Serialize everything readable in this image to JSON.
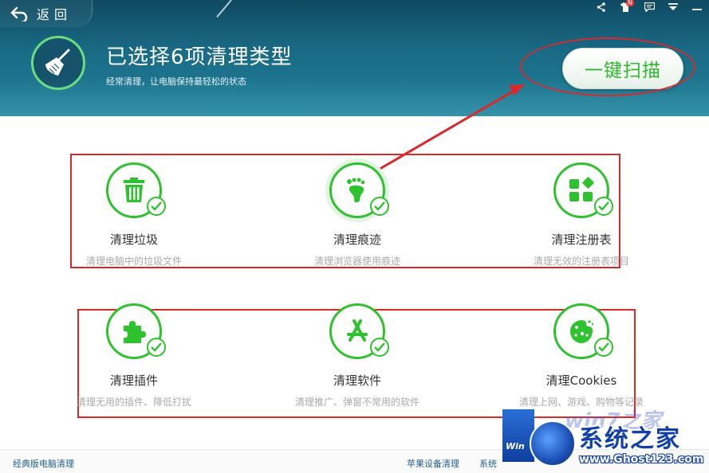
{
  "header": {
    "back_label": "返回",
    "title": "已选择6项清理类型",
    "subtitle": "经常清理，让电脑保持最轻松的状态",
    "scan_button": "一键扫描",
    "notification_badge": "N"
  },
  "items": [
    {
      "title": "清理垃圾",
      "desc": "清理电脑中的垃圾文件",
      "icon": "trash-icon"
    },
    {
      "title": "清理痕迹",
      "desc": "清理浏览器使用痕迹",
      "icon": "footprint-icon"
    },
    {
      "title": "清理注册表",
      "desc": "清理无效的注册表项目",
      "icon": "registry-icon"
    },
    {
      "title": "清理插件",
      "desc": "清理无用的插件、降低打扰",
      "icon": "puzzle-icon"
    },
    {
      "title": "清理软件",
      "desc": "清理推广、弹窗不常用的软件",
      "icon": "app-store-icon"
    },
    {
      "title": "清理Cookies",
      "desc": "清理上网、游戏、购物等记录",
      "icon": "cookie-icon"
    }
  ],
  "footer": {
    "classic_link": "经典版电脑清理",
    "apple_link": "苹果设备清理",
    "system_link": "系统"
  },
  "watermark": {
    "brand": "系统之家",
    "url": "www.Ghost123.com",
    "faded": "win7之家",
    "bar_text": "Win"
  },
  "colors": {
    "accent_green": "#2ec22e",
    "header_blue": "#1a6b86",
    "annotation_red": "#d9292b"
  }
}
